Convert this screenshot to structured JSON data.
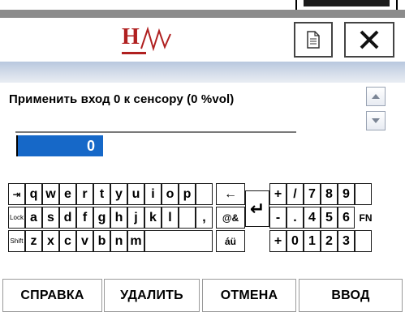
{
  "header": {
    "logo": "HW"
  },
  "title_buttons": {
    "doc_icon": "document-icon",
    "close_icon": "close-icon"
  },
  "prompt": {
    "text": "Применить вход 0 к сенсору (0 %vol)"
  },
  "input": {
    "value": "0"
  },
  "keyboard": {
    "row1": [
      "q",
      "w",
      "e",
      "r",
      "t",
      "y",
      "u",
      "i",
      "o",
      "p"
    ],
    "row2": [
      "a",
      "s",
      "d",
      "f",
      "g",
      "h",
      "j",
      "k",
      "l"
    ],
    "row3": [
      "z",
      "x",
      "c",
      "v",
      "b",
      "n",
      "m"
    ],
    "special": {
      "tab": "⇥",
      "lock": "Lock",
      "shift": "Shift",
      "backspace": "←",
      "symbols": "@&",
      "accents": "áü",
      "enter": "↵",
      "fn": "FN",
      "comma_dot": ",",
      "slash": "/"
    },
    "numpad_row1": [
      "+",
      "/",
      "7",
      "8",
      "9"
    ],
    "numpad_row2": [
      "-",
      ".",
      "4",
      "5",
      "6"
    ],
    "numpad_row3": [
      "+",
      "0",
      "1",
      "2",
      "3"
    ]
  },
  "buttons": {
    "help": "СПРАВКА",
    "delete": "УДАЛИТЬ",
    "cancel": "ОТМЕНА",
    "enter": "ВВОД"
  },
  "colors": {
    "accent": "#1668c8",
    "logo": "#b02020"
  }
}
